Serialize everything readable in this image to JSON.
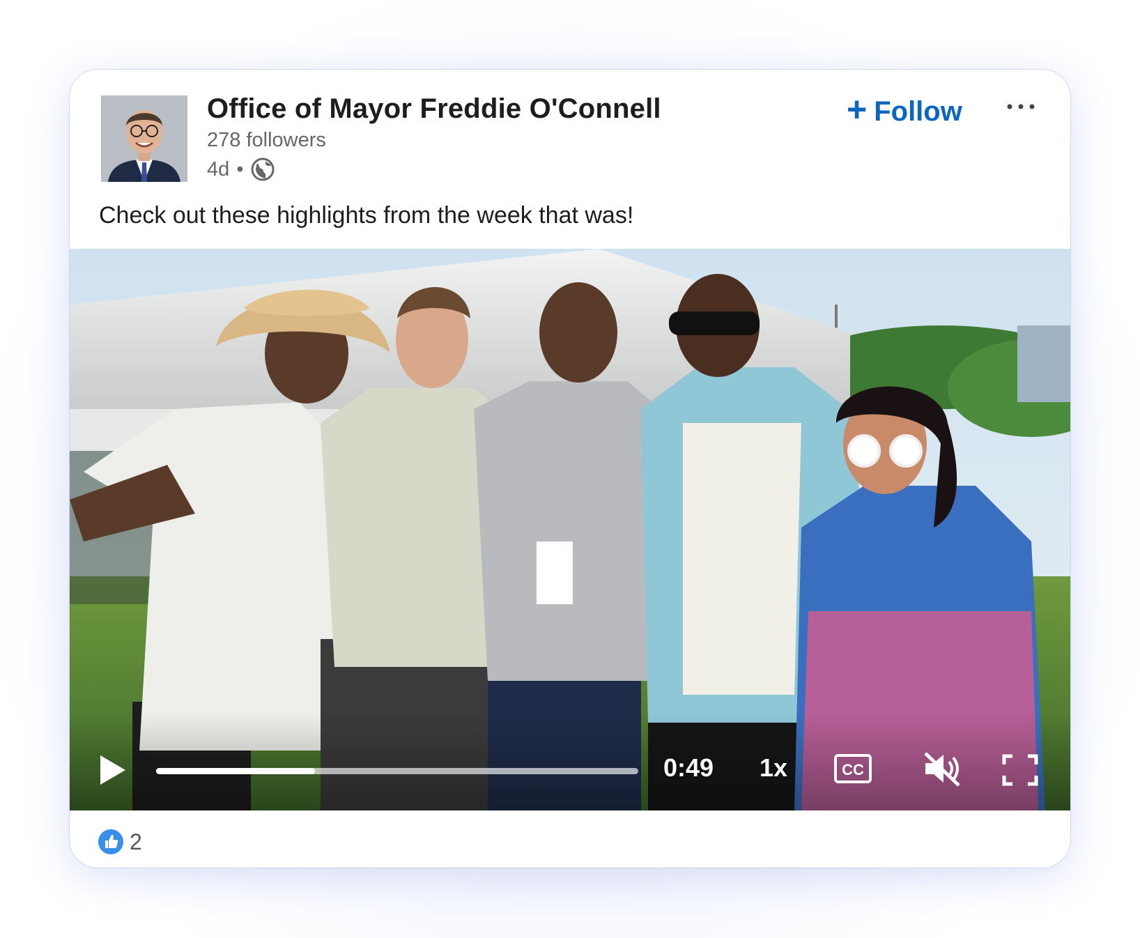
{
  "post": {
    "author": "Office of Mayor Freddie O'Connell",
    "followers": "278 followers",
    "age": "4d",
    "separator": "•",
    "visibility_icon": "globe-icon",
    "follow_icon": "plus-icon",
    "follow_label": "Follow",
    "more_icon": "more-horizontal-icon",
    "text": "Check out these highlights from the week that was!"
  },
  "video": {
    "play_icon": "play-icon",
    "progress": 0.33,
    "time": "0:49",
    "speed": "1x",
    "cc_label": "CC",
    "mute_icon": "muted-speaker-icon",
    "fullscreen_icon": "fullscreen-icon"
  },
  "reactions": {
    "icon": "like-icon",
    "count": "2"
  },
  "colors": {
    "accent": "#0a66c2",
    "text_primary": "#1d1d1d",
    "text_secondary": "#666666"
  }
}
